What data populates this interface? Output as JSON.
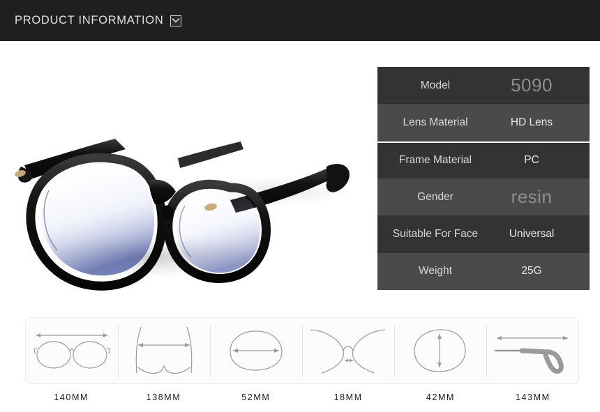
{
  "header": {
    "title": "PRODUCT INFORMATION",
    "toggle_icon": "chevron-down-icon"
  },
  "product": {
    "alt": "Black round-frame eyeglasses with blue-light filtering lenses",
    "frame_color": "#0c0c0c",
    "lens_tint": "#3f4f9c",
    "rivet_color": "#c4a87a"
  },
  "spec_table": {
    "rows": [
      {
        "label": "Model",
        "value": "5090",
        "style": "big",
        "band": "dark"
      },
      {
        "label": "Lens Material",
        "value": "HD Lens",
        "style": "normal",
        "band": "light"
      },
      {
        "label": "Frame Material",
        "value": "PC",
        "style": "normal",
        "band": "dark"
      },
      {
        "label": "Gender",
        "value": "resin",
        "style": "big",
        "band": "light"
      },
      {
        "label": "Suitable For Face",
        "value": "Universal",
        "style": "normal",
        "band": "dark"
      },
      {
        "label": "Weight",
        "value": "25G",
        "style": "normal",
        "band": "light"
      }
    ],
    "colors": {
      "dark_band": "#333333",
      "light_band": "#4a4a4a",
      "separator": "#ffffff"
    }
  },
  "measurements": {
    "cells": [
      {
        "icon": "frame-total-width-icon",
        "label": "140MM"
      },
      {
        "icon": "frame-front-width-icon",
        "label": "138MM"
      },
      {
        "icon": "lens-width-icon",
        "label": "52MM"
      },
      {
        "icon": "bridge-width-icon",
        "label": "18MM"
      },
      {
        "icon": "lens-height-icon",
        "label": "42MM"
      },
      {
        "icon": "temple-length-icon",
        "label": "143MM"
      }
    ],
    "line_color": "#9a9a9a"
  },
  "palette": {
    "header_bg": "#1f1f1f",
    "page_bg": "#ffffff",
    "panel_bg": "#fcfcfc",
    "panel_border": "#ededed"
  }
}
